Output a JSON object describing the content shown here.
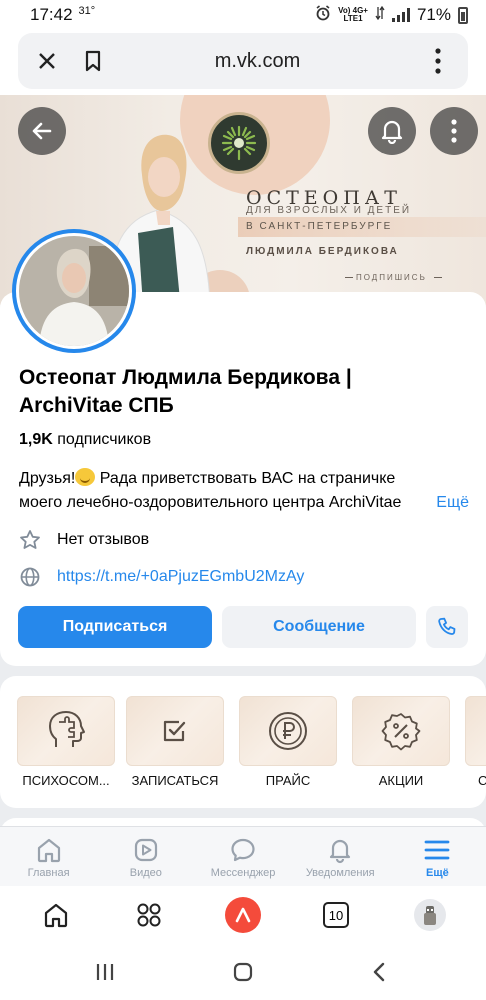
{
  "status_bar": {
    "time": "17:42",
    "temperature": "31°",
    "network_label": "Vo) 4G+\nLTE1",
    "battery": "71%"
  },
  "browser": {
    "url": "m.vk.com"
  },
  "cover": {
    "title": "ОСТЕОПАТ",
    "subtitle": "ДЛЯ ВЗРОСЛЫХ И ДЕТЕЙ",
    "location": "В САНКТ-ПЕТЕРБУРГЕ",
    "name": "ЛЮДМИЛА БЕРДИКОВА",
    "cta": "ПОДПИШИСЬ"
  },
  "profile": {
    "title": "Остеопат Людмила Бердикова | ArchiVitae СПБ",
    "followers_count": "1,9K",
    "followers_label": "подписчиков",
    "description_line1_before_emoji": "Друзья!",
    "description_line1_after_emoji": " Рада приветствовать ВАС на страничке",
    "description_line2": "моего лечебно-оздоровительного центра ArchiVitae",
    "more_label": "Ещё",
    "reviews": "Нет отзывов",
    "link": "https://t.me/+0aPjuzEGmbU2MzAy",
    "subscribe_button": "Подписаться",
    "message_button": "Сообщение"
  },
  "apps": [
    {
      "label": "ПСИХОСОМ...",
      "icon": "head-puzzle-icon"
    },
    {
      "label": "ЗАПИСАТЬСЯ",
      "icon": "checkbox-icon"
    },
    {
      "label": "ПРАЙС",
      "icon": "ruble-coin-icon"
    },
    {
      "label": "АКЦИИ",
      "icon": "percent-badge-icon"
    },
    {
      "label": "С",
      "icon": "app-tile-partial"
    }
  ],
  "tab_bar": {
    "items": [
      {
        "label": "Главная",
        "icon": "home-icon"
      },
      {
        "label": "Видео",
        "icon": "video-icon"
      },
      {
        "label": "Мессенджер",
        "icon": "messenger-icon"
      },
      {
        "label": "Уведомления",
        "icon": "bell-icon"
      },
      {
        "label": "Ещё",
        "icon": "menu-icon",
        "active": true
      }
    ]
  },
  "browser_toolbar": {
    "tabs_count": "10"
  },
  "colors": {
    "accent": "#2688eb",
    "cover_peach": "#f0d2bf",
    "alice_red": "#f44b3b"
  }
}
